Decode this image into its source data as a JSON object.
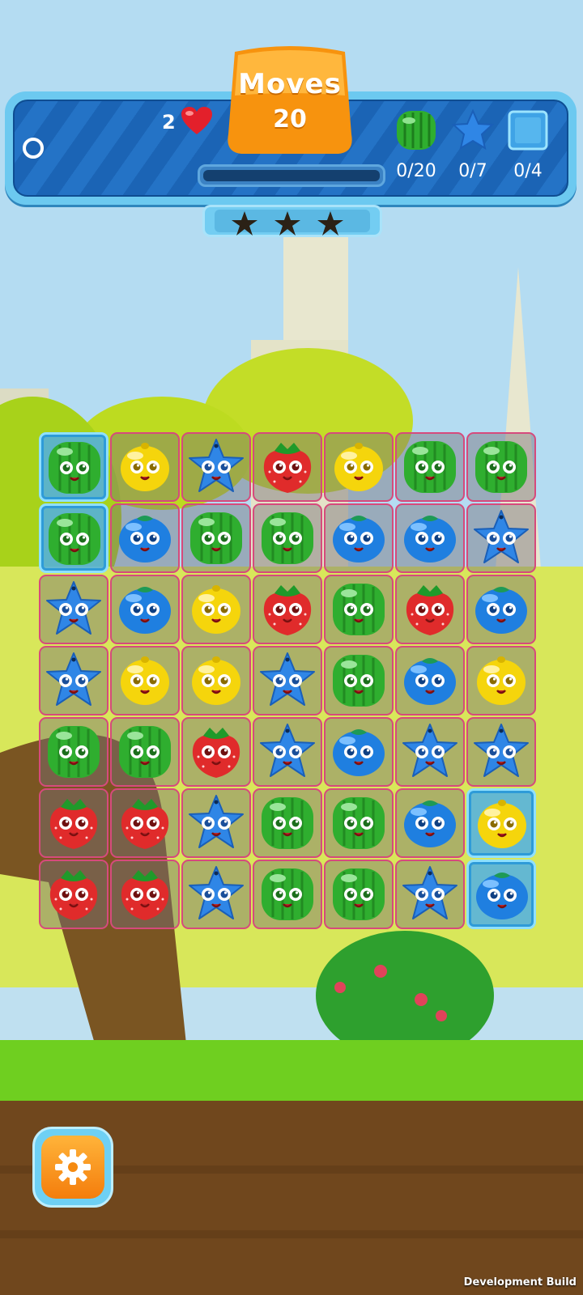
{
  "hud": {
    "lives": "2",
    "moves_label": "Moves",
    "moves_value": "20",
    "score_progress": 0,
    "stars_earned": 0,
    "stars_total": 3,
    "goals": [
      {
        "icon": "watermelon-icon",
        "count": "0/20"
      },
      {
        "icon": "blue-star-icon",
        "count": "0/7"
      },
      {
        "icon": "ice-block-icon",
        "count": "0/4"
      }
    ]
  },
  "board": {
    "rows": 7,
    "cols": 7,
    "grid": [
      [
        "watermelon",
        "lemon",
        "star",
        "strawberry",
        "lemon",
        "watermelon",
        "watermelon"
      ],
      [
        "watermelon",
        "blueberry",
        "watermelon",
        "watermelon",
        "blueberry",
        "blueberry",
        "star"
      ],
      [
        "star",
        "blueberry",
        "lemon",
        "strawberry",
        "watermelon",
        "strawberry",
        "blueberry"
      ],
      [
        "star",
        "lemon",
        "lemon",
        "star",
        "watermelon",
        "blueberry",
        "lemon"
      ],
      [
        "watermelon",
        "watermelon",
        "strawberry",
        "star",
        "blueberry",
        "star",
        "star"
      ],
      [
        "strawberry",
        "strawberry",
        "star",
        "watermelon",
        "watermelon",
        "blueberry",
        "lemon"
      ],
      [
        "strawberry",
        "strawberry",
        "star",
        "watermelon",
        "watermelon",
        "star",
        "blueberry"
      ]
    ],
    "ice_cells": [
      [
        0,
        0
      ],
      [
        1,
        0
      ],
      [
        5,
        6
      ],
      [
        6,
        6
      ]
    ]
  },
  "colors": {
    "watermelon": "#2fae2f",
    "lemon": "#f5d50c",
    "star": "#2f86e6",
    "strawberry": "#e02b2b",
    "blueberry": "#1f7fe0",
    "hud_blue": "#1b64b5",
    "accent_orange": "#f59a12"
  },
  "footer": {
    "settings_icon": "gear-icon",
    "dev_build_label": "Development Build"
  }
}
